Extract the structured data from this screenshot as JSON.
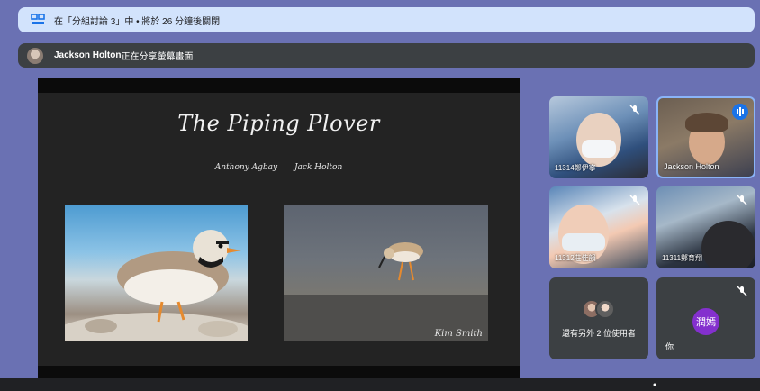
{
  "banner": {
    "text": "在「分組討論 3」中 • 將於 26 分鐘後關閉"
  },
  "presenting": {
    "name": "Jackson Holton",
    "suffix": "正在分享螢幕畫面"
  },
  "slide": {
    "title": "The Piping Plover",
    "author1": "Anthony Agbay",
    "author2": "Jack Holton",
    "photo_credit": "Kim Smith"
  },
  "participants": [
    {
      "name": "11314鄭伊寧",
      "muted": true
    },
    {
      "name": "Jackson Holton",
      "speaking": true
    },
    {
      "name": "11312莊佳韻",
      "muted": true
    },
    {
      "name": "11311鄭育翔",
      "muted": true
    }
  ],
  "others": {
    "text": "還有另外 2 位使用者"
  },
  "self": {
    "avatar_text": "潤嫣",
    "label": "你",
    "muted": true
  },
  "colors": {
    "accent": "#1a73e8",
    "banner_bg": "#d2e3fc",
    "page_bg": "#6a71b3",
    "self_avatar": "#8430ce"
  }
}
